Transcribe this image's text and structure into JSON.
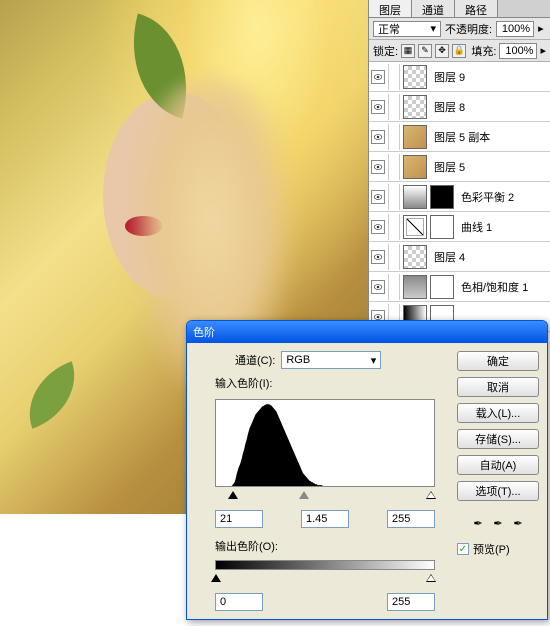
{
  "layers_panel": {
    "tabs": [
      "图层",
      "通道",
      "路径"
    ],
    "blend_mode": "正常",
    "opacity_label": "不透明度:",
    "opacity_value": "100%",
    "lock_label": "锁定:",
    "fill_label": "填充:",
    "fill_value": "100%",
    "layers": [
      {
        "name": "图层 9",
        "thumb": "trans"
      },
      {
        "name": "图层 8",
        "thumb": "trans"
      },
      {
        "name": "图层 5 副本",
        "thumb": "photo"
      },
      {
        "name": "图层 5",
        "thumb": "photo"
      },
      {
        "name": "色彩平衡 2",
        "thumb": "adj",
        "mask": "black"
      },
      {
        "name": "曲线 1",
        "thumb": "curves",
        "mask": "white"
      },
      {
        "name": "图层 4",
        "thumb": "trans"
      },
      {
        "name": "色相/饱和度 1",
        "thumb": "hue",
        "mask": "white"
      },
      {
        "name": "",
        "thumb": "gradient",
        "mask": "white"
      }
    ]
  },
  "levels_dialog": {
    "title": "色阶",
    "channel_label": "通道(C):",
    "channel_value": "RGB",
    "input_label": "输入色阶(I):",
    "input_black": "21",
    "input_gamma": "1.45",
    "input_white": "255",
    "output_label": "输出色阶(O):",
    "output_black": "0",
    "output_white": "255",
    "buttons": {
      "ok": "确定",
      "cancel": "取消",
      "load": "载入(L)...",
      "save": "存储(S)...",
      "auto": "自动(A)",
      "options": "选项(T)..."
    },
    "preview_label": "预览(P)"
  },
  "chart_data": {
    "type": "area",
    "title": "",
    "xlabel": "",
    "ylabel": "",
    "x_range": [
      0,
      255
    ],
    "values": [
      0,
      0,
      0,
      0,
      0,
      0,
      0,
      0,
      0,
      0,
      0,
      0,
      0,
      0,
      0,
      0,
      0,
      0,
      0,
      1,
      2,
      3,
      5,
      8,
      12,
      15,
      18,
      20,
      22,
      25,
      28,
      32,
      35,
      38,
      42,
      45,
      48,
      52,
      55,
      58,
      60,
      62,
      64,
      66,
      68,
      70,
      72,
      73,
      74,
      75,
      76,
      77,
      78,
      79,
      80,
      80,
      81,
      81,
      82,
      82,
      82,
      82,
      82,
      81,
      81,
      80,
      79,
      78,
      77,
      76,
      75,
      73,
      71,
      69,
      67,
      65,
      63,
      61,
      59,
      57,
      55,
      53,
      51,
      49,
      47,
      45,
      43,
      41,
      39,
      37,
      35,
      33,
      31,
      29,
      27,
      25,
      23,
      21,
      19,
      17,
      15,
      13,
      12,
      11,
      10,
      9,
      8,
      7,
      6,
      5,
      5,
      4,
      4,
      3,
      3,
      2,
      2,
      2,
      1,
      1,
      1,
      1,
      1,
      1,
      0,
      0,
      0,
      0
    ]
  }
}
